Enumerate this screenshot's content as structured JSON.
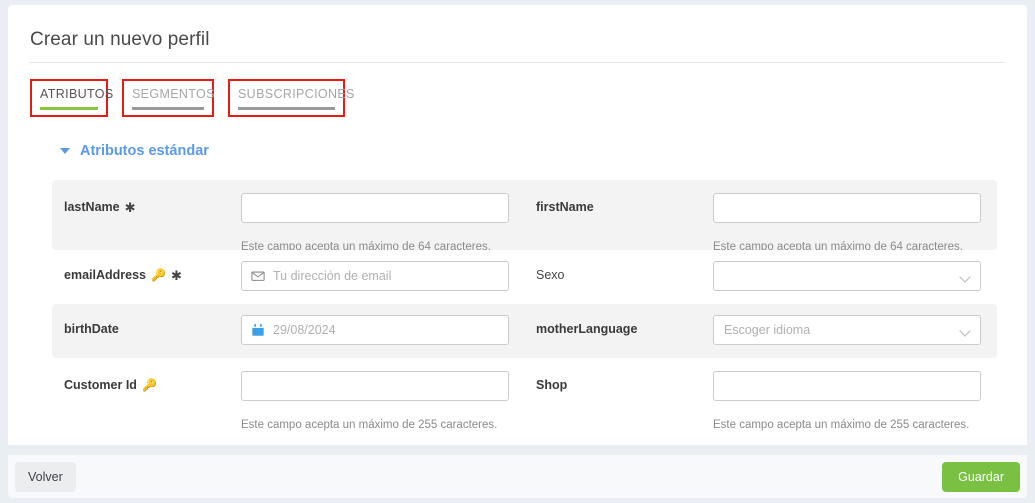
{
  "page": {
    "title": "Crear un nuevo perfil"
  },
  "tabs": [
    {
      "label": "ATRIBUTOS",
      "active": true
    },
    {
      "label": "SEGMENTOS",
      "active": false
    },
    {
      "label": "SUBSCRIPCIONES",
      "active": false
    }
  ],
  "section": {
    "title": "Atributos estándar",
    "caret_icon": "caret-down-icon"
  },
  "fields": {
    "lastName": {
      "label": "lastName",
      "required_marker": "✱",
      "value": "",
      "placeholder": "",
      "hint": "Este campo acepta un máximo de 64 caracteres."
    },
    "firstName": {
      "label": "firstName",
      "value": "",
      "placeholder": "",
      "hint": "Este campo acepta un máximo de 64 caracteres."
    },
    "emailAddress": {
      "label": "emailAddress",
      "key_marker": "🔑",
      "required_marker": "✱",
      "value": "",
      "placeholder": "Tu dirección de email",
      "icon": "envelope-icon"
    },
    "sexo": {
      "label": "Sexo",
      "selected": "",
      "icon": "chevron-down-icon"
    },
    "birthDate": {
      "label": "birthDate",
      "value": "",
      "placeholder": "29/08/2024",
      "icon": "calendar-icon"
    },
    "motherLanguage": {
      "label": "motherLanguage",
      "selected": "Escoger idioma",
      "icon": "chevron-down-icon"
    },
    "customerId": {
      "label": "Customer Id",
      "key_marker": "🔑",
      "value": "",
      "placeholder": "",
      "hint": "Este campo acepta un máximo de 255 caracteres."
    },
    "shop": {
      "label": "Shop",
      "value": "",
      "placeholder": "",
      "hint": "Este campo acepta un máximo de 255 caracteres."
    }
  },
  "footer": {
    "back_label": "Volver",
    "save_label": "Guardar"
  },
  "colors": {
    "accent_blue": "#5b9ae8",
    "active_tab_underline": "#8cc63f",
    "inactive_tab_underline": "#9a9a9a",
    "annotation_box": "#e51b18",
    "save_button": "#7ac143",
    "page_background": "#e9eef5",
    "row_stripe": "#f3f3f3"
  }
}
